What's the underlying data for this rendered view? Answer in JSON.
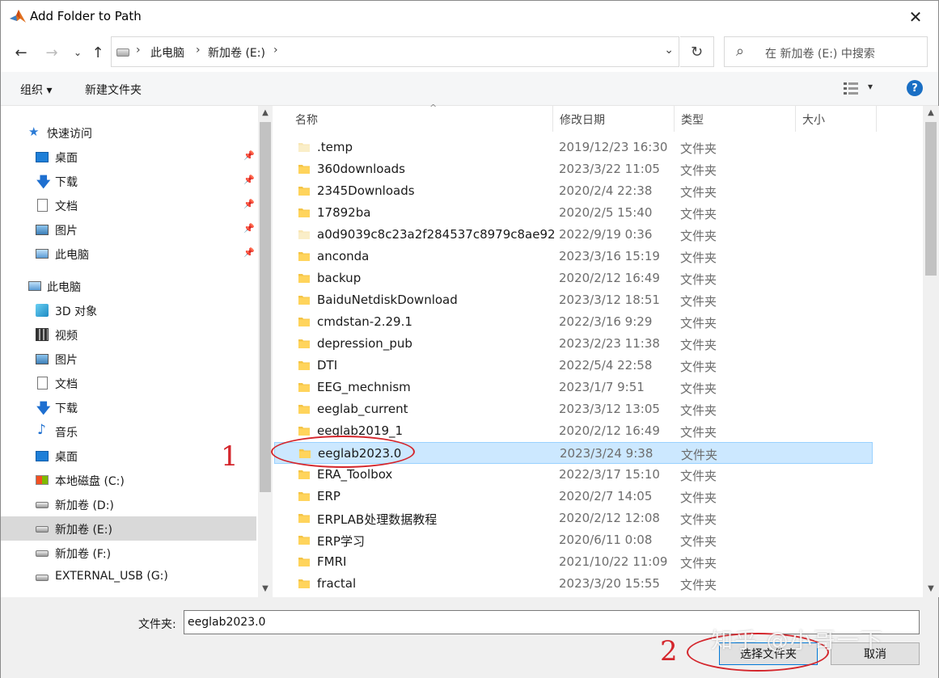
{
  "window": {
    "title": "Add Folder to Path"
  },
  "address": {
    "crumbs": [
      "此电脑",
      "新加卷 (E:)"
    ],
    "search_placeholder": "在 新加卷 (E:) 中搜索"
  },
  "toolbar": {
    "organize_label": "组织 ▾",
    "new_folder_label": "新建文件夹",
    "help_label": "?"
  },
  "nav": {
    "quick_access": "快速访问",
    "quick_items": [
      "桌面",
      "下载",
      "文档",
      "图片",
      "此电脑"
    ],
    "this_pc": "此电脑",
    "pc_items": [
      "3D 对象",
      "视频",
      "图片",
      "文档",
      "下载",
      "音乐",
      "桌面",
      "本地磁盘 (C:)",
      "新加卷 (D:)",
      "新加卷 (E:)",
      "新加卷 (F:)",
      "EXTERNAL_USB (G:)"
    ],
    "selected": "新加卷 (E:)"
  },
  "columns": {
    "name": "名称",
    "date": "修改日期",
    "type": "类型",
    "size": "大小"
  },
  "files": [
    {
      "name": ".temp",
      "date": "2019/12/23 16:30",
      "type": "文件夹"
    },
    {
      "name": "360downloads",
      "date": "2023/3/22 11:05",
      "type": "文件夹"
    },
    {
      "name": "2345Downloads",
      "date": "2020/2/4 22:38",
      "type": "文件夹"
    },
    {
      "name": "17892ba",
      "date": "2020/2/5 15:40",
      "type": "文件夹"
    },
    {
      "name": "a0d9039c8c23a2f284537c8979c8ae92",
      "date": "2022/9/19 0:36",
      "type": "文件夹"
    },
    {
      "name": "anconda",
      "date": "2023/3/16 15:19",
      "type": "文件夹"
    },
    {
      "name": "backup",
      "date": "2020/2/12 16:49",
      "type": "文件夹"
    },
    {
      "name": "BaiduNetdiskDownload",
      "date": "2023/3/12 18:51",
      "type": "文件夹"
    },
    {
      "name": "cmdstan-2.29.1",
      "date": "2022/3/16 9:29",
      "type": "文件夹"
    },
    {
      "name": "depression_pub",
      "date": "2023/2/23 11:38",
      "type": "文件夹"
    },
    {
      "name": "DTI",
      "date": "2022/5/4 22:58",
      "type": "文件夹"
    },
    {
      "name": "EEG_mechnism",
      "date": "2023/1/7 9:51",
      "type": "文件夹"
    },
    {
      "name": "eeglab_current",
      "date": "2023/3/12 13:05",
      "type": "文件夹"
    },
    {
      "name": "eeglab2019_1",
      "date": "2020/2/12 16:49",
      "type": "文件夹"
    },
    {
      "name": "eeglab2023.0",
      "date": "2023/3/24 9:38",
      "type": "文件夹",
      "selected": true
    },
    {
      "name": "ERA_Toolbox",
      "date": "2022/3/17 15:10",
      "type": "文件夹"
    },
    {
      "name": "ERP",
      "date": "2020/2/7 14:05",
      "type": "文件夹"
    },
    {
      "name": "ERPLAB处理数据教程",
      "date": "2020/2/12 12:08",
      "type": "文件夹"
    },
    {
      "name": "ERP学习",
      "date": "2020/6/11 0:08",
      "type": "文件夹"
    },
    {
      "name": "FMRI",
      "date": "2021/10/22 11:09",
      "type": "文件夹"
    },
    {
      "name": "fractal",
      "date": "2023/3/20 15:55",
      "type": "文件夹"
    }
  ],
  "footer": {
    "folder_label": "文件夹:",
    "folder_value": "eeglab2023.0",
    "select_button": "选择文件夹",
    "cancel_button": "取消"
  },
  "annotations": {
    "mark1": "1",
    "mark2": "2",
    "watermark": "知乎 @小哥一下"
  },
  "colors": {
    "selection": "#cce8ff",
    "folder": "#f4c446",
    "annotation": "#d4262c"
  }
}
